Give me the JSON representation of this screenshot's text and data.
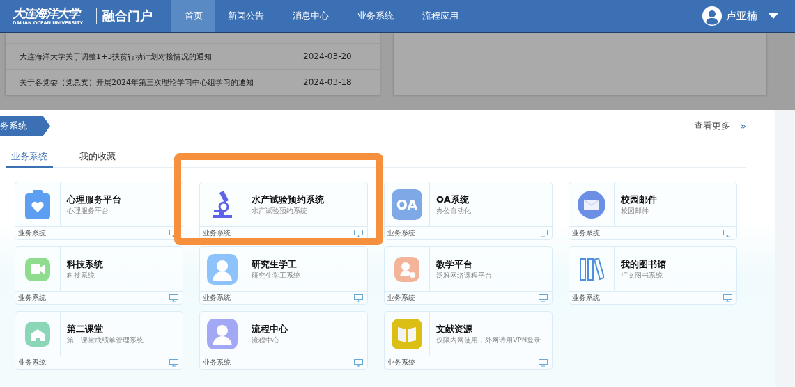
{
  "header": {
    "logo": {
      "name": "大连海洋大学",
      "english": "DALIAN OCEAN UNIVERSITY"
    },
    "portal": "融合门户",
    "nav": [
      {
        "label": "首页",
        "selected": true
      },
      {
        "label": "新闻公告",
        "selected": false
      },
      {
        "label": "消息中心",
        "selected": false
      },
      {
        "label": "业务系统",
        "selected": false
      },
      {
        "label": "流程应用",
        "selected": false
      }
    ],
    "user": {
      "name": "卢亚楠"
    }
  },
  "news": [
    {
      "title": "大连海洋大学关于调整1+3扶贫行动计划对接情况的通知",
      "date": "2024-03-20"
    },
    {
      "title": "关于各党委（党总支）开展2024年第三次理论学习中心组学习的通知",
      "date": "2024-03-18"
    }
  ],
  "section": {
    "ribbon": "务系统",
    "more": "查看更多",
    "more_arrow": "»",
    "tabs": [
      {
        "label": "业务系统",
        "selected": true
      },
      {
        "label": "我的收藏",
        "selected": false
      }
    ],
    "apps": [
      {
        "title": "心理服务平台",
        "subtitle": "心理服务平台",
        "category": "业务系统"
      },
      {
        "title": "水产试验预约系统",
        "subtitle": "水产试验预约系统",
        "category": "业务系统"
      },
      {
        "title": "OA系统",
        "subtitle": "办公自动化",
        "category": "业务系统",
        "logo_text": "OA"
      },
      {
        "title": "校园邮件",
        "subtitle": "校园邮件",
        "category": "业务系统"
      },
      {
        "title": "科技系统",
        "subtitle": "科技系统",
        "category": "业务系统"
      },
      {
        "title": "研究生学工",
        "subtitle": "研究生学工系统",
        "category": "业务系统"
      },
      {
        "title": "教学平台",
        "subtitle": "泛雅网络课程平台",
        "category": "业务系统"
      },
      {
        "title": "我的图书馆",
        "subtitle": "汇文图书系统",
        "category": "业务系统"
      },
      {
        "title": "第二课堂",
        "subtitle": "第二课堂成绩单管理系统",
        "category": "业务系统"
      },
      {
        "title": "流程中心",
        "subtitle": "流程中心",
        "category": "业务系统"
      },
      {
        "title": "文献资源",
        "subtitle": "仅限内网使用，外网请用VPN登录",
        "category": "业务系统"
      }
    ]
  }
}
